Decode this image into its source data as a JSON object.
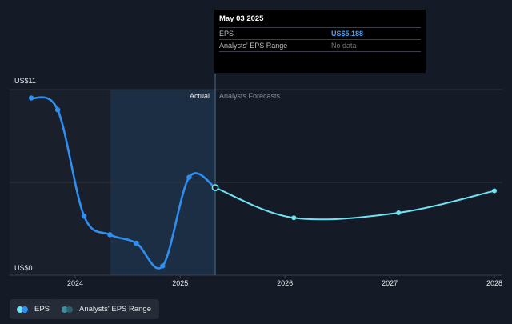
{
  "tooltip": {
    "date": "May 03 2025",
    "rows": [
      {
        "label": "EPS",
        "value": "US$5.188"
      },
      {
        "label": "Analysts' EPS Range",
        "value": "No data"
      }
    ]
  },
  "legend": {
    "items": [
      {
        "label": "EPS"
      },
      {
        "label": "Analysts' EPS Range"
      }
    ]
  },
  "colors": {
    "background": "#151b26",
    "eps": "#2f8ef0",
    "forecast": "#6fe3f2",
    "highlight": "#1d3a57",
    "gridline": "#2e3540"
  },
  "chart_data": {
    "type": "line",
    "ylim": [
      0,
      11
    ],
    "y_tick_labels": [
      "US$11",
      "US$0"
    ],
    "x_tick_labels": [
      "2024",
      "2025",
      "2026",
      "2027",
      "2028"
    ],
    "section_labels": [
      "Actual",
      "Analysts Forecasts"
    ],
    "series": [
      {
        "name": "EPS",
        "values": [
          {
            "x": "2023-08-01",
            "y": 10.5
          },
          {
            "x": "2023-11-01",
            "y": 9.8
          },
          {
            "x": "2024-02-01",
            "y": 3.5
          },
          {
            "x": "2024-05-01",
            "y": 2.4
          },
          {
            "x": "2024-08-01",
            "y": 1.9
          },
          {
            "x": "2024-11-01",
            "y": 0.55
          },
          {
            "x": "2025-02-01",
            "y": 5.8
          },
          {
            "x": "2025-05-03",
            "y": 5.188
          }
        ]
      },
      {
        "values": [
          {
            "x": "2025-05-03",
            "y": 5.188
          },
          {
            "x": "2026-02-01",
            "y": 3.4
          },
          {
            "x": "2027-02-01",
            "y": 3.7
          },
          {
            "x": "2028-01-01",
            "y": 5.0
          }
        ]
      }
    ]
  }
}
